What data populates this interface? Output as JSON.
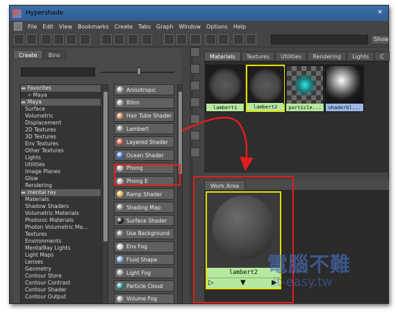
{
  "window": {
    "title": "Hypershade",
    "close_glyph": "✕"
  },
  "menu": [
    "File",
    "Edit",
    "View",
    "Bookmarks",
    "Create",
    "Tabs",
    "Graph",
    "Window",
    "Options",
    "Help"
  ],
  "toolbar": {
    "show_label": "Show"
  },
  "left_tabs": [
    "Create",
    "Bins"
  ],
  "tree": [
    {
      "label": "Favorites",
      "kind": "hdr"
    },
    {
      "label": "Maya",
      "kind": "lvl2",
      "plus": "+"
    },
    {
      "label": "Maya",
      "kind": "hdr"
    },
    {
      "label": "Surface",
      "kind": "lvl1"
    },
    {
      "label": "Volumetric",
      "kind": "lvl1"
    },
    {
      "label": "Displacement",
      "kind": "lvl1"
    },
    {
      "label": "2D Textures",
      "kind": "lvl1"
    },
    {
      "label": "3D Textures",
      "kind": "lvl1"
    },
    {
      "label": "Env Textures",
      "kind": "lvl1"
    },
    {
      "label": "Other Textures",
      "kind": "lvl1"
    },
    {
      "label": "Lights",
      "kind": "lvl1"
    },
    {
      "label": "Utilities",
      "kind": "lvl1"
    },
    {
      "label": "Image Planes",
      "kind": "lvl1"
    },
    {
      "label": "Glow",
      "kind": "lvl1"
    },
    {
      "label": "Rendering",
      "kind": "lvl1"
    },
    {
      "label": "mental ray",
      "kind": "hdr"
    },
    {
      "label": "Materials",
      "kind": "lvl1"
    },
    {
      "label": "Shadow Shaders",
      "kind": "lvl1"
    },
    {
      "label": "Volumetric Materials",
      "kind": "lvl1"
    },
    {
      "label": "Photonic Materials",
      "kind": "lvl1"
    },
    {
      "label": "Photon Volumetric Ma...",
      "kind": "lvl1"
    },
    {
      "label": "Textures",
      "kind": "lvl1"
    },
    {
      "label": "Environments",
      "kind": "lvl1"
    },
    {
      "label": "MentalRay Lights",
      "kind": "lvl1"
    },
    {
      "label": "Light Maps",
      "kind": "lvl1"
    },
    {
      "label": "Lenses",
      "kind": "lvl1"
    },
    {
      "label": "Geometry",
      "kind": "lvl1"
    },
    {
      "label": "Contour Store",
      "kind": "lvl1"
    },
    {
      "label": "Contour Contrast",
      "kind": "lvl1"
    },
    {
      "label": "Contour Shader",
      "kind": "lvl1"
    },
    {
      "label": "Contour Output",
      "kind": "lvl1"
    }
  ],
  "nodes": [
    {
      "label": "Anisotropic",
      "icon": "sphere-icon",
      "color": "#9a9a9a"
    },
    {
      "label": "Blinn",
      "icon": "sphere-icon",
      "color": "#9a9a9a"
    },
    {
      "label": "Hair Tube Shader",
      "icon": "hair-tube-icon",
      "color": "#c8734a"
    },
    {
      "label": "Lambert",
      "icon": "sphere-icon",
      "color": "#8a8a8a"
    },
    {
      "label": "Layered Shader",
      "icon": "layered-shader-icon",
      "color": "#d04a3a"
    },
    {
      "label": "Ocean Shader",
      "icon": "ocean-icon",
      "color": "#3a7ad0"
    },
    {
      "label": "Phong",
      "icon": "sphere-icon",
      "color": "#a8a8a8"
    },
    {
      "label": "Phong E",
      "icon": "sphere-icon",
      "color": "#a8a8a8"
    },
    {
      "label": "Ramp Shader",
      "icon": "ramp-icon",
      "color": "#d8a83a"
    },
    {
      "label": "Shading Map",
      "icon": "shading-map-icon",
      "color": "#8a8a8a"
    },
    {
      "label": "Surface Shader",
      "icon": "surface-shader-icon",
      "color": "#111111"
    },
    {
      "label": "Use Background",
      "icon": "background-icon",
      "color": "#7a7a7a"
    },
    {
      "label": "Env Fog",
      "icon": "env-fog-icon",
      "color": "#c8c8c8"
    },
    {
      "label": "Fluid Shape",
      "icon": "fluid-icon",
      "color": "#6aa0d8"
    },
    {
      "label": "Light Fog",
      "icon": "light-fog-icon",
      "color": "#9a9a9a"
    },
    {
      "label": "Particle Cloud",
      "icon": "particle-cloud-icon",
      "color": "#2a8a8a"
    },
    {
      "label": "Volume Fog",
      "icon": "volume-fog-icon",
      "color": "#9a9a9a"
    }
  ],
  "right_tabs": [
    "Materials",
    "Textures",
    "Utilities",
    "Rendering",
    "Lights",
    "C"
  ],
  "swatches": [
    {
      "label": "lambert1",
      "kind": "sphere",
      "selected": false
    },
    {
      "label": "lambert2",
      "kind": "sphere",
      "selected": true
    },
    {
      "label": "particle...",
      "kind": "particle",
      "selected": false
    },
    {
      "label": "shaderGl...",
      "kind": "glossy",
      "selected": false
    }
  ],
  "work_area": {
    "tab": "Work Area",
    "node_label": "lambert2",
    "ports": [
      "▷",
      "▼",
      "▶"
    ]
  },
  "watermark": {
    "chinese": "電腦不難",
    "url": "it-easy.tw"
  },
  "colors": {
    "highlight_red": "#e21d1d",
    "selection_yellow": "#e4e000",
    "label_green": "#b6e8a0"
  }
}
